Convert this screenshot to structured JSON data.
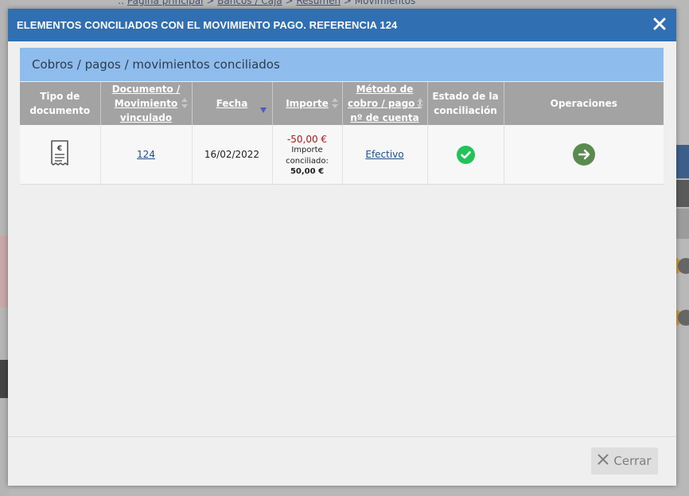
{
  "background": {
    "breadcrumb": {
      "prefix": "::",
      "home": "Página principal",
      "sep": ">",
      "bancos": "Bancos / Caja",
      "resumen": "Resumen",
      "movimientos": "Movimientos"
    }
  },
  "modal": {
    "title": "ELEMENTOS CONCILIADOS CON EL MOVIMIENTO PAGO. REFERENCIA 124",
    "section_title": "Cobros / pagos / movimientos conciliados",
    "columns": {
      "tipo": "Tipo de documento",
      "documento": "Documento / Movimiento vinculado",
      "fecha": "Fecha",
      "importe": "Importe",
      "metodo": "Método de cobro / pago / nº de cuenta",
      "estado": "Estado de la conciliación",
      "operaciones": "Operaciones"
    },
    "rows": [
      {
        "tipo_icon": "receipt-euro-icon",
        "documento": "124",
        "fecha": "16/02/2022",
        "importe": "-50,00 €",
        "importe_conciliado_label": "Importe conciliado:",
        "importe_conciliado": "50,00 €",
        "metodo": "Efectivo",
        "estado_icon": "check-circle-icon",
        "operacion_icon": "arrow-right-circle-icon"
      }
    ],
    "close_button": "Cerrar"
  },
  "colors": {
    "header": "#2f6fb2",
    "section": "#8ebcec",
    "table_header": "#a3a3a3",
    "negative_amount": "#b01818",
    "status_ok": "#22c45a",
    "operation": "#5a8a4e"
  }
}
